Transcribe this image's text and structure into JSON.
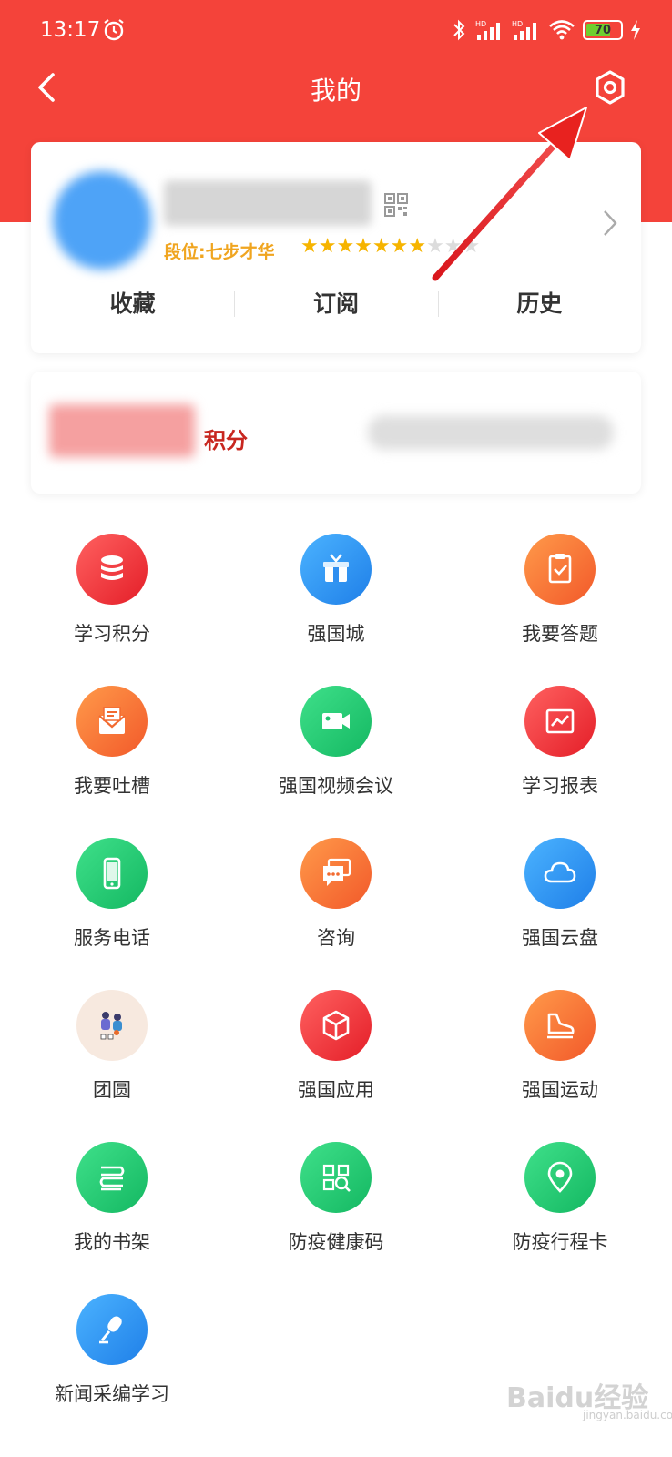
{
  "status_bar": {
    "time": "13:17",
    "signal1": "HD",
    "signal2": "HD",
    "battery": "70"
  },
  "header": {
    "title": "我的"
  },
  "profile": {
    "level_text": "段位:七步才华",
    "stars_on": "★★★★★★★",
    "stars_off": "★★★",
    "tabs": [
      "收藏",
      "订阅",
      "历史"
    ]
  },
  "points": {
    "label": "积分"
  },
  "grid": {
    "items": [
      {
        "label": "学习积分",
        "icon": "database-icon",
        "color": "red"
      },
      {
        "label": "强国城",
        "icon": "gift-shop-icon",
        "color": "blue"
      },
      {
        "label": "我要答题",
        "icon": "clipboard-check-icon",
        "color": "orange"
      },
      {
        "label": "我要吐槽",
        "icon": "envelope-icon",
        "color": "orange"
      },
      {
        "label": "强国视频会议",
        "icon": "video-camera-icon",
        "color": "green"
      },
      {
        "label": "学习报表",
        "icon": "chart-icon",
        "color": "red"
      },
      {
        "label": "服务电话",
        "icon": "phone-icon",
        "color": "green"
      },
      {
        "label": "咨询",
        "icon": "chat-icon",
        "color": "orange"
      },
      {
        "label": "强国云盘",
        "icon": "cloud-icon",
        "color": "blue"
      },
      {
        "label": "团圆",
        "icon": "family-illustration-icon",
        "color": "beige"
      },
      {
        "label": "强国应用",
        "icon": "cube-icon",
        "color": "red"
      },
      {
        "label": "强国运动",
        "icon": "sneaker-icon",
        "color": "orange"
      },
      {
        "label": "我的书架",
        "icon": "books-icon",
        "color": "green"
      },
      {
        "label": "防疫健康码",
        "icon": "qr-scan-icon",
        "color": "green"
      },
      {
        "label": "防疫行程卡",
        "icon": "location-pin-icon",
        "color": "green"
      },
      {
        "label": "新闻采编学习",
        "icon": "microphone-icon",
        "color": "blue"
      }
    ]
  },
  "watermark": {
    "main": "Baidu经验",
    "sub": "jingyan.baidu.com"
  }
}
